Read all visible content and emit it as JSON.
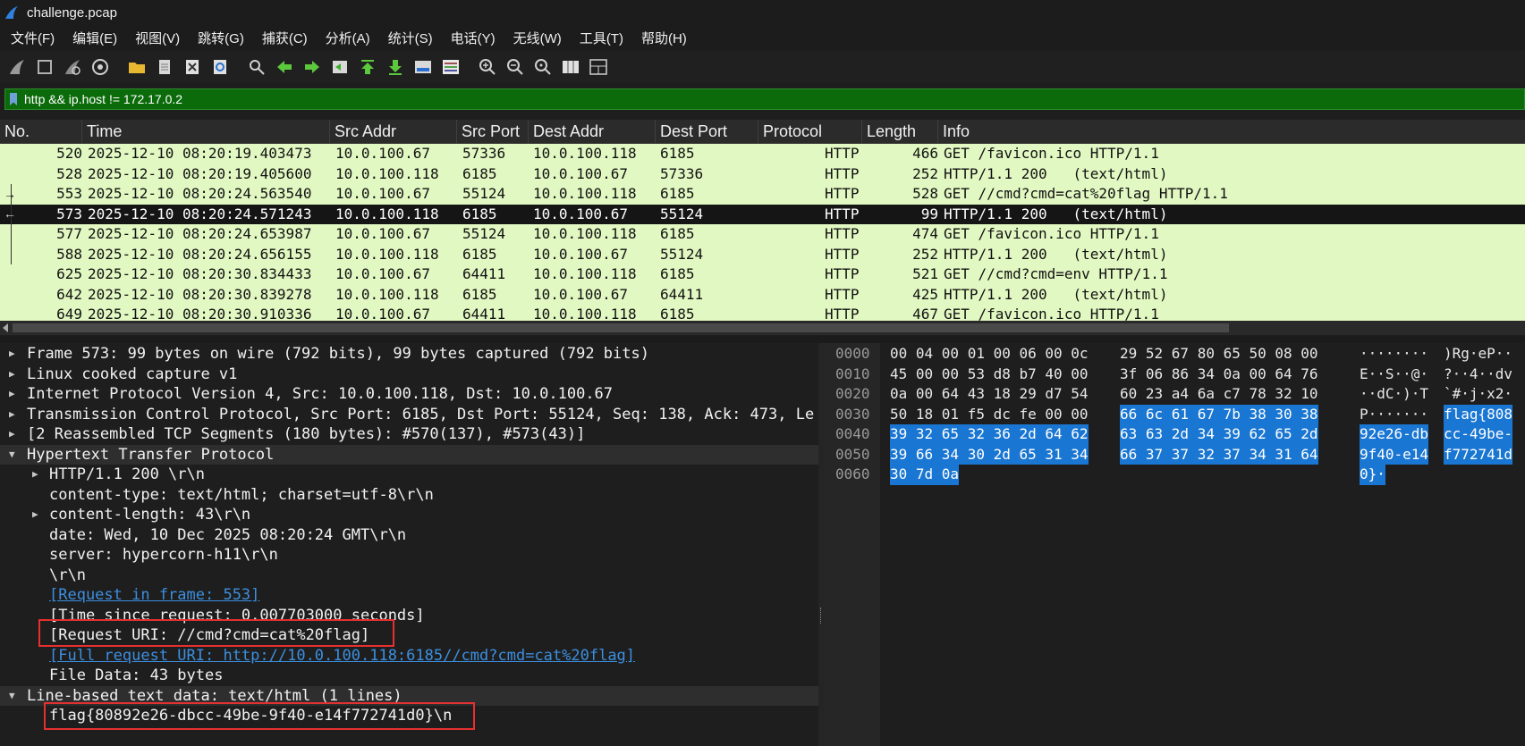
{
  "window": {
    "title": "challenge.pcap"
  },
  "menu": [
    "文件(F)",
    "编辑(E)",
    "视图(V)",
    "跳转(G)",
    "捕获(C)",
    "分析(A)",
    "统计(S)",
    "电话(Y)",
    "无线(W)",
    "工具(T)",
    "帮助(H)"
  ],
  "toolbar": {
    "icons": [
      "shark-fin-start-icon",
      "stop-icon",
      "restart-icon",
      "capture-options-icon",
      "open-folder-icon",
      "file-icon",
      "close-file-icon",
      "reload-icon",
      "find-icon",
      "go-back-icon",
      "go-forward-icon",
      "go-to-packet-icon",
      "first-packet-icon",
      "last-packet-icon",
      "auto-scroll-icon",
      "colorize-icon",
      "zoom-in-icon",
      "zoom-out-icon",
      "normal-size-icon",
      "resize-columns-icon",
      "layout-icon"
    ]
  },
  "filter": {
    "value": "http && ip.host != 172.17.0.2"
  },
  "packet_list": {
    "columns": [
      "No.",
      "Time",
      "Src Addr",
      "Src Port",
      "Dest Addr",
      "Dest Port",
      "Protocol",
      "Length",
      "Info"
    ],
    "rows": [
      {
        "no": "520",
        "time": "2025-12-10 08:20:19.403473",
        "src": "10.0.100.67",
        "sport": "57336",
        "dst": "10.0.100.118",
        "dport": "6185",
        "proto": "HTTP",
        "len": "466",
        "info": "GET /favicon.ico HTTP/1.1"
      },
      {
        "no": "528",
        "time": "2025-12-10 08:20:19.405600",
        "src": "10.0.100.118",
        "sport": "6185",
        "dst": "10.0.100.67",
        "dport": "57336",
        "proto": "HTTP",
        "len": "252",
        "info": "HTTP/1.1 200   (text/html)"
      },
      {
        "no": "553",
        "time": "2025-12-10 08:20:24.563540",
        "src": "10.0.100.67",
        "sport": "55124",
        "dst": "10.0.100.118",
        "dport": "6185",
        "proto": "HTTP",
        "len": "528",
        "info": "GET //cmd?cmd=cat%20flag HTTP/1.1"
      },
      {
        "no": "573",
        "time": "2025-12-10 08:20:24.571243",
        "src": "10.0.100.118",
        "sport": "6185",
        "dst": "10.0.100.67",
        "dport": "55124",
        "proto": "HTTP",
        "len": "99",
        "info": "HTTP/1.1 200   (text/html)"
      },
      {
        "no": "577",
        "time": "2025-12-10 08:20:24.653987",
        "src": "10.0.100.67",
        "sport": "55124",
        "dst": "10.0.100.118",
        "dport": "6185",
        "proto": "HTTP",
        "len": "474",
        "info": "GET /favicon.ico HTTP/1.1"
      },
      {
        "no": "588",
        "time": "2025-12-10 08:20:24.656155",
        "src": "10.0.100.118",
        "sport": "6185",
        "dst": "10.0.100.67",
        "dport": "55124",
        "proto": "HTTP",
        "len": "252",
        "info": "HTTP/1.1 200   (text/html)"
      },
      {
        "no": "625",
        "time": "2025-12-10 08:20:30.834433",
        "src": "10.0.100.67",
        "sport": "64411",
        "dst": "10.0.100.118",
        "dport": "6185",
        "proto": "HTTP",
        "len": "521",
        "info": "GET //cmd?cmd=env HTTP/1.1"
      },
      {
        "no": "642",
        "time": "2025-12-10 08:20:30.839278",
        "src": "10.0.100.118",
        "sport": "6185",
        "dst": "10.0.100.67",
        "dport": "64411",
        "proto": "HTTP",
        "len": "425",
        "info": "HTTP/1.1 200   (text/html)"
      },
      {
        "no": "649",
        "time": "2025-12-10 08:20:30.910336",
        "src": "10.0.100.67",
        "sport": "64411",
        "dst": "10.0.100.118",
        "dport": "6185",
        "proto": "HTTP",
        "len": "467",
        "info": "GET /favicon.ico HTTP/1.1"
      }
    ],
    "selected_no": "573"
  },
  "details": [
    {
      "arrow": "▶",
      "text": "Frame 573: 99 bytes on wire (792 bits), 99 bytes captured (792 bits)"
    },
    {
      "arrow": "▶",
      "text": "Linux cooked capture v1"
    },
    {
      "arrow": "▶",
      "text": "Internet Protocol Version 4, Src: 10.0.100.118, Dst: 10.0.100.67"
    },
    {
      "arrow": "▶",
      "text": "Transmission Control Protocol, Src Port: 6185, Dst Port: 55124, Seq: 138, Ack: 473, Le"
    },
    {
      "arrow": "▶",
      "text": "[2 Reassembled TCP Segments (180 bytes): #570(137), #573(43)]"
    },
    {
      "arrow": "▼",
      "text": "Hypertext Transfer Protocol"
    },
    {
      "arrow": "▶",
      "text": "HTTP/1.1 200 \\r\\n"
    },
    {
      "arrow": "",
      "text": "content-type: text/html; charset=utf-8\\r\\n"
    },
    {
      "arrow": "▶",
      "text": "content-length: 43\\r\\n"
    },
    {
      "arrow": "",
      "text": "date: Wed, 10 Dec 2025 08:20:24 GMT\\r\\n"
    },
    {
      "arrow": "",
      "text": "server: hypercorn-h11\\r\\n"
    },
    {
      "arrow": "",
      "text": "\\r\\n"
    },
    {
      "arrow": "",
      "text": "[Request in frame: 553]"
    },
    {
      "arrow": "",
      "text": "[Time since request: 0.007703000 seconds]"
    },
    {
      "arrow": "",
      "text": "[Request URI: //cmd?cmd=cat%20flag]"
    },
    {
      "arrow": "",
      "text": "[Full request URI: http://10.0.100.118:6185//cmd?cmd=cat%20flag]"
    },
    {
      "arrow": "",
      "text": "File Data: 43 bytes"
    },
    {
      "arrow": "▼",
      "text": "Line-based text data: text/html (1 lines)"
    },
    {
      "arrow": "",
      "text": "flag{80892e26-dbcc-49be-9f40-e14f772741d0}\\n"
    }
  ],
  "bytes": {
    "offsets": [
      "0000",
      "0010",
      "0020",
      "0030",
      "0040",
      "0050",
      "0060"
    ],
    "hex_a": [
      "00 04 00 01 00 06 00 0c",
      "45 00 00 53 d8 b7 40 00",
      "0a 00 64 43 18 29 d7 54",
      "50 18 01 f5 dc fe 00 00",
      "39 32 65 32 36 2d 64 62",
      "39 66 34 30 2d 65 31 34",
      "30 7d 0a"
    ],
    "hex_b": [
      "29 52 67 80 65 50 08 00",
      "3f 06 86 34 0a 00 64 76",
      "60 23 a4 6a c7 78 32 10",
      "66 6c 61 67 7b 38 30 38",
      "63 63 2d 34 39 62 65 2d",
      "66 37 37 32 37 34 31 64",
      ""
    ],
    "ascii_a": [
      "········",
      "E··S··@·",
      "··dC·)·T",
      "P·······",
      "92e26-db",
      "9f40-e14",
      "0}·"
    ],
    "ascii_b": [
      ")Rg·eP··",
      "?··4··dv",
      "`#·j·x2·",
      "flag{808",
      "cc-49be-",
      "f772741d",
      ""
    ]
  }
}
